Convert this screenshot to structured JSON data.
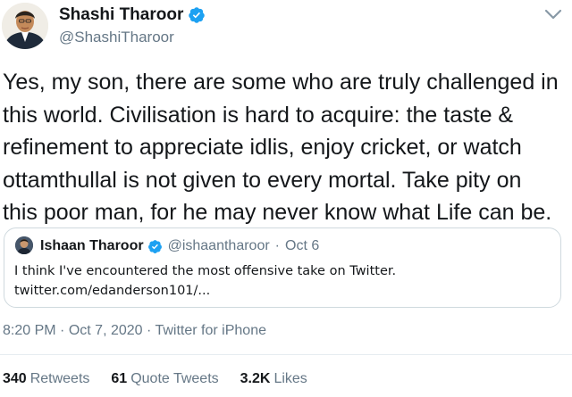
{
  "author": {
    "name": "Shashi Tharoor",
    "handle": "@ShashiTharoor",
    "avatar": "author-avatar",
    "verified_icon": "verified-badge-icon",
    "more_icon": "more-options-icon"
  },
  "tweet_text": "Yes, my son, there are some who are truly challenged in\nthis world. Civilisation is hard to acquire: the taste &\nrefinement to appreciate idlis, enjoy cricket, or watch\nottamthullal is not given to every mortal. Take pity on\nthis poor man, for he may never know what Life can be.",
  "quoted": {
    "name": "Ishaan Tharoor",
    "handle": "@ishaantharoor",
    "separator": "·",
    "date": "Oct 6",
    "text_line1": "I think I've encountered the most offensive take on Twitter.",
    "text_line2": "twitter.com/edanderson101/..."
  },
  "meta": {
    "time": "8:20 PM",
    "sep1": "·",
    "date": "Oct 7, 2020",
    "sep2": "·",
    "source": "Twitter for iPhone"
  },
  "stats": [
    {
      "count": "340",
      "label": "Retweets"
    },
    {
      "count": "61",
      "label": "Quote Tweets"
    },
    {
      "count": "3.2K",
      "label": "Likes"
    }
  ],
  "colors": {
    "text": "#14171a",
    "secondary": "#657786",
    "verified": "#1da1f2",
    "border": "#cfd9de"
  }
}
